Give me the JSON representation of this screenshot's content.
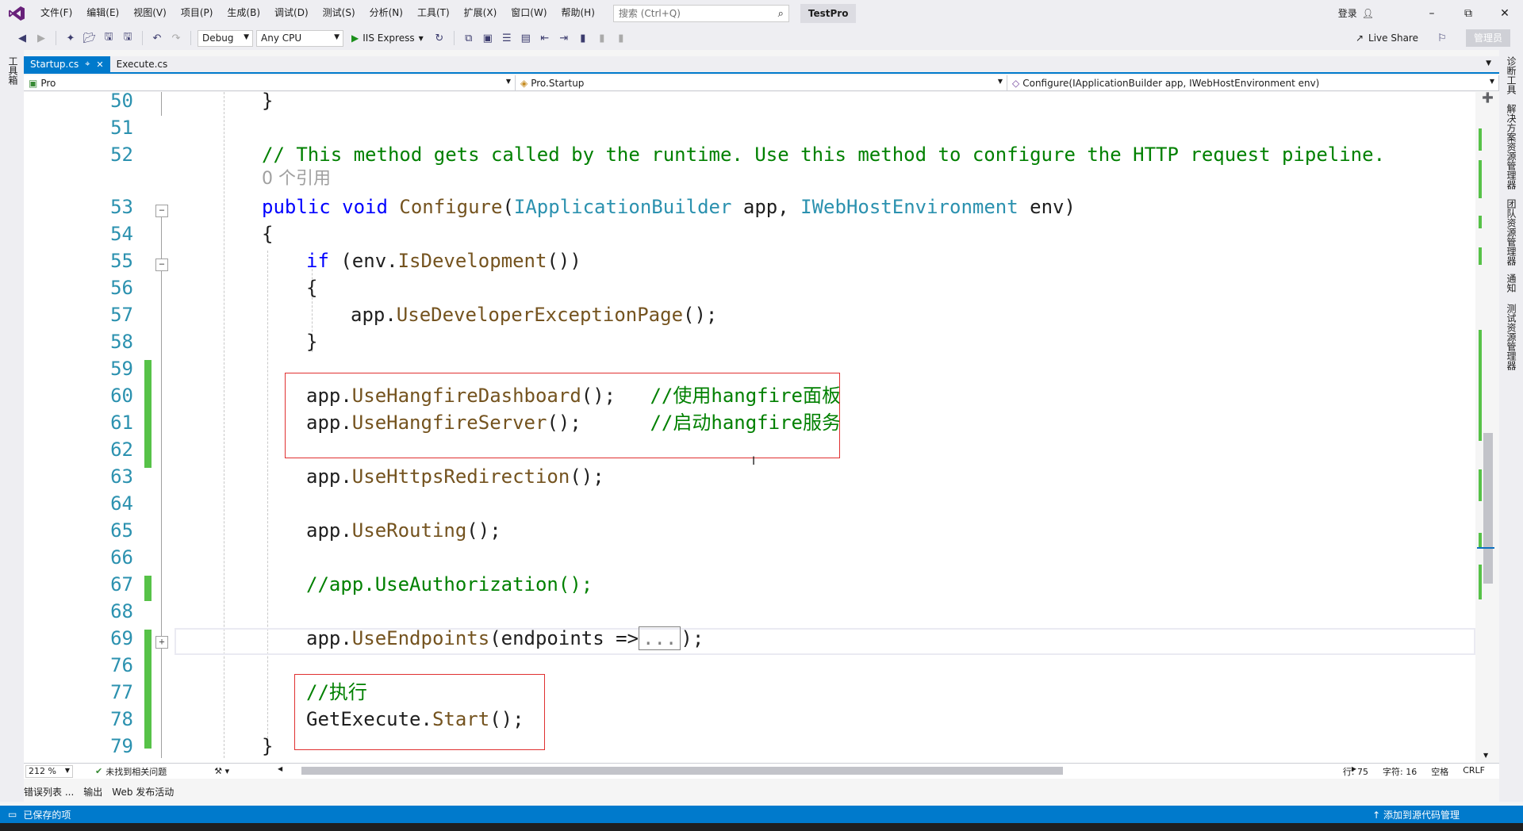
{
  "menu": {
    "items": [
      "文件(F)",
      "编辑(E)",
      "视图(V)",
      "项目(P)",
      "生成(B)",
      "调试(D)",
      "测试(S)",
      "分析(N)",
      "工具(T)",
      "扩展(X)",
      "窗口(W)",
      "帮助(H)"
    ],
    "search_placeholder": "搜索 (Ctrl+Q)",
    "solution_name": "TestPro",
    "login": "登录"
  },
  "toolbar": {
    "config": "Debug",
    "platform": "Any CPU",
    "run_label": "IIS Express",
    "live_share": "Live Share",
    "admin": "管理员"
  },
  "left_strip": {
    "label": "工具箱"
  },
  "right_strip": {
    "labels": [
      "诊断工具",
      "解决方案资源管理器",
      "团队资源管理器",
      "通知",
      "测试资源管理器"
    ]
  },
  "tabs": [
    {
      "label": "Startup.cs",
      "active": true
    },
    {
      "label": "Execute.cs",
      "active": false
    }
  ],
  "navbar": {
    "project": "Pro",
    "type": "Pro.Startup",
    "member": "Configure(IApplicationBuilder app, IWebHostEnvironment env)"
  },
  "code": {
    "line_numbers": [
      "50",
      "51",
      "52",
      "53",
      "54",
      "55",
      "56",
      "57",
      "58",
      "59",
      "60",
      "61",
      "62",
      "63",
      "64",
      "65",
      "66",
      "67",
      "68",
      "69",
      "76",
      "77",
      "78",
      "79"
    ],
    "l50": "}",
    "l52": "// This method gets called by the runtime. Use this method to configure the HTTP request pipeline.",
    "codelens": "0 个引用",
    "l53_kw": "public void",
    "l53_fn": "Configure",
    "l53_p1": "(",
    "l53_t1": "IApplicationBuilder",
    "l53_p2": " app, ",
    "l53_t2": "IWebHostEnvironment",
    "l53_p3": " env)",
    "l54": "{",
    "l55_kw": "if",
    "l55_a": " (env.",
    "l55_fn": "IsDevelopment",
    "l55_b": "())",
    "l56": "{",
    "l57_a": "app.",
    "l57_fn": "UseDeveloperExceptionPage",
    "l57_b": "();",
    "l58": "}",
    "l60_a": "app.",
    "l60_fn": "UseHangfireDashboard",
    "l60_b": "();   ",
    "l60_cm": "//使用hangfire面板",
    "l61_a": "app.",
    "l61_fn": "UseHangfireServer",
    "l61_b": "();      ",
    "l61_cm": "//启动hangfire服务",
    "l63_a": "app.",
    "l63_fn": "UseHttpsRedirection",
    "l63_b": "();",
    "l65_a": "app.",
    "l65_fn": "UseRouting",
    "l65_b": "();",
    "l67_cm": "//app.UseAuthorization();",
    "l69_a": "app.",
    "l69_fn": "UseEndpoints",
    "l69_b": "(endpoints =>",
    "l69_collapsed": "...",
    "l69_c": ");",
    "l77_cm": "//执行",
    "l78_a": "GetExecute.",
    "l78_fn": "Start",
    "l78_b": "();",
    "l79": "}"
  },
  "editor_bottom": {
    "zoom": "212 %",
    "issues": "未找到相关问题",
    "line": "行: 75",
    "char": "字符: 16",
    "whitespace": "空格",
    "eol": "CRLF"
  },
  "output_tabs": [
    "错误列表 ...",
    "输出",
    "Web 发布活动"
  ],
  "status": {
    "saved": "已保存的项",
    "source_control": "添加到源代码管理"
  },
  "colors": {
    "accent": "#007acc",
    "keyword": "#0000ff",
    "type": "#2b91af",
    "method": "#74531f",
    "comment": "#008000",
    "change_bar": "#57c248",
    "highlight_box": "#e03030"
  }
}
